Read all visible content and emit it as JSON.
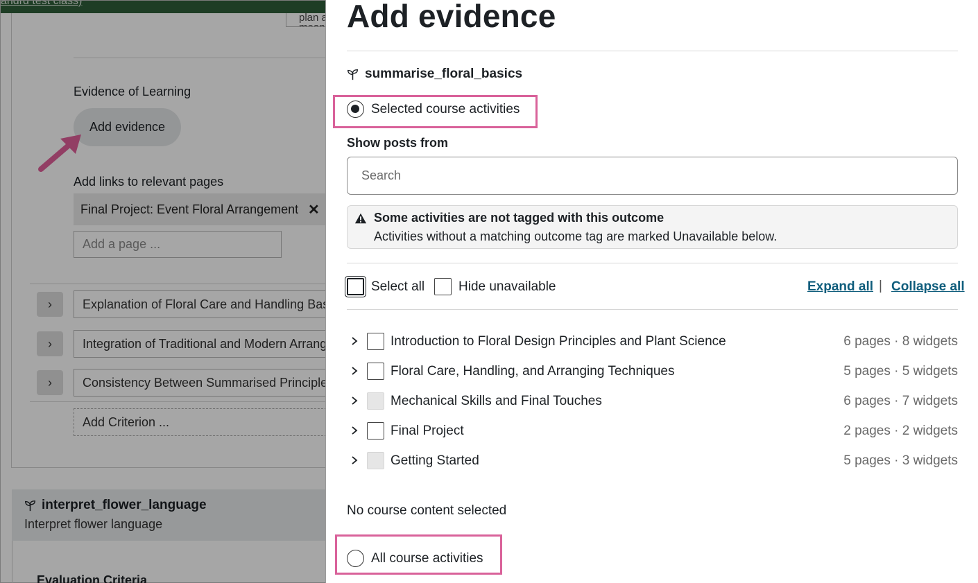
{
  "background": {
    "top_link": "andrd test class)",
    "clipped_field_text": "plan a\nmeanin",
    "evidence_label": "Evidence of Learning",
    "add_evidence_button": "Add evidence",
    "links_label": "Add links to relevant pages",
    "linked_page_chip": "Final Project: Event Floral Arrangement",
    "page_input_placeholder": "Add a page ...",
    "criteria": [
      {
        "toggle": "›",
        "text": "Explanation of Floral Care and Handling Basics"
      },
      {
        "toggle": "›",
        "text": "Integration of Traditional and Modern Arranging"
      },
      {
        "toggle": "›",
        "text": "Consistency Between Summarised Principles"
      }
    ],
    "add_criterion": "Add Criterion ...",
    "next_outcome": {
      "name": "interpret_flower_language",
      "description": "Interpret flower language"
    },
    "evaluation_heading": "Evaluation Criteria"
  },
  "drawer": {
    "title": "Add evidence",
    "outcome_name": "summarise_floral_basics",
    "radio_selected": "Selected course activities",
    "show_posts_label": "Show posts from",
    "search_placeholder": "Search",
    "alert": {
      "title": "Some activities are not tagged with this outcome",
      "message": "Activities without a matching outcome tag are marked Unavailable below."
    },
    "select_all": "Select all",
    "hide_unavailable": "Hide unavailable",
    "expand_all": "Expand all",
    "separator": "|",
    "collapse_all": "Collapse all",
    "activities": [
      {
        "title": "Introduction to Floral Design Principles and Plant Science",
        "meta": "6 pages · 8 widgets",
        "available": true
      },
      {
        "title": "Floral Care, Handling, and Arranging Techniques",
        "meta": "5 pages · 5 widgets",
        "available": true
      },
      {
        "title": "Mechanical Skills and Final Touches",
        "meta": "6 pages · 7 widgets",
        "available": false
      },
      {
        "title": "Final Project",
        "meta": "2 pages · 2 widgets",
        "available": true
      },
      {
        "title": "Getting Started",
        "meta": "5 pages · 3 widgets",
        "available": false
      }
    ],
    "selection_status": "No course content selected",
    "radio_all": "All course activities"
  },
  "colors": {
    "highlight": "#d9629a",
    "link": "#0f5d7c",
    "topbar": "#2f5f3a"
  }
}
